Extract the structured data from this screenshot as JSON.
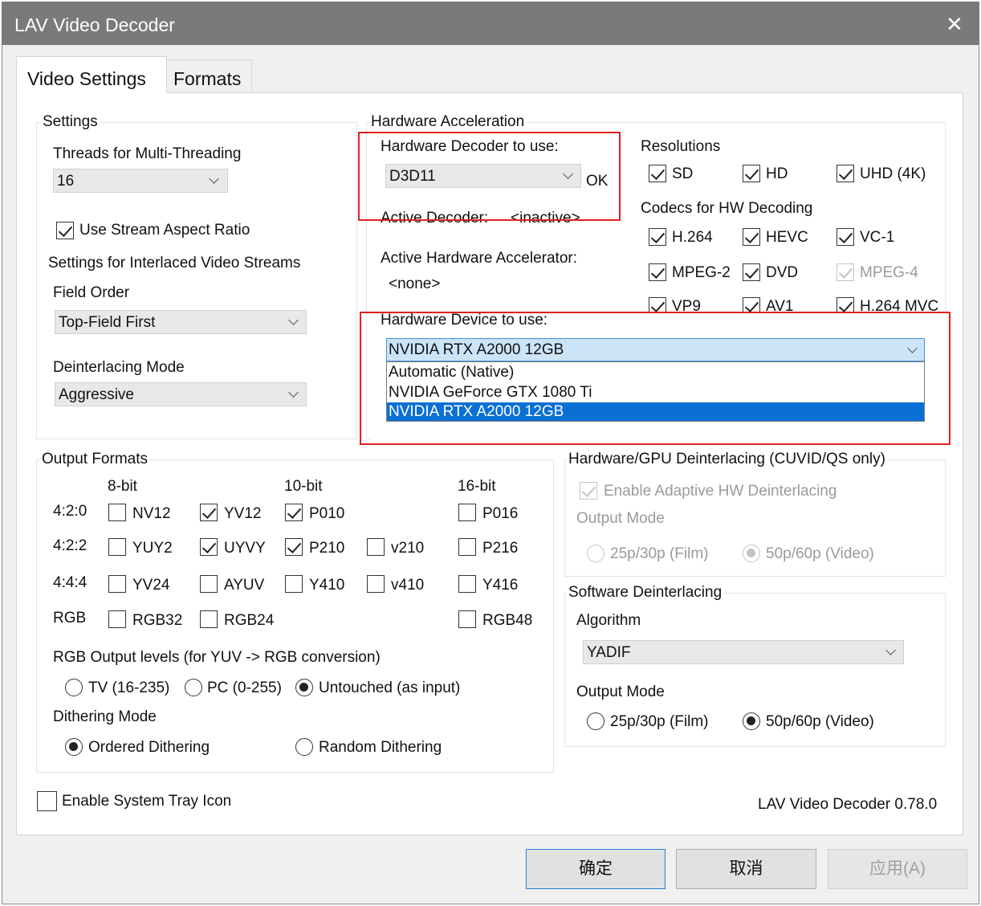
{
  "window": {
    "title": "LAV Video Decoder"
  },
  "tabs": [
    {
      "label": "Video Settings",
      "active": true
    },
    {
      "label": "Formats",
      "active": false
    }
  ],
  "settings": {
    "group_label": "Settings",
    "threads_label": "Threads for Multi-Threading",
    "threads_value": "16",
    "stream_aspect_label": "Use Stream Aspect Ratio",
    "interlaced_label": "Settings for Interlaced Video Streams",
    "field_order_label": "Field Order",
    "field_order_value": "Top-Field First",
    "deint_mode_label": "Deinterlacing Mode",
    "deint_mode_value": "Aggressive"
  },
  "hw_accel": {
    "group_label": "Hardware Acceleration",
    "decoder_label": "Hardware Decoder to use:",
    "decoder_value": "D3D11",
    "decoder_status": "OK",
    "active_decoder_label": "Active Decoder:",
    "active_decoder_value": "<inactive>",
    "active_accel_label": "Active Hardware Accelerator:",
    "active_accel_value": "<none>",
    "device_label": "Hardware Device to use:",
    "device_value": "NVIDIA RTX A2000 12GB",
    "device_options": [
      "Automatic (Native)",
      "NVIDIA GeForce GTX 1080 Ti",
      "NVIDIA RTX A2000 12GB"
    ]
  },
  "resolutions": {
    "label": "Resolutions",
    "items": [
      {
        "label": "SD",
        "checked": true
      },
      {
        "label": "HD",
        "checked": true
      },
      {
        "label": "UHD (4K)",
        "checked": true
      }
    ]
  },
  "codecs": {
    "label": "Codecs for HW Decoding",
    "items": [
      {
        "label": "H.264",
        "checked": true
      },
      {
        "label": "HEVC",
        "checked": true
      },
      {
        "label": "VC-1",
        "checked": true
      },
      {
        "label": "MPEG-2",
        "checked": true
      },
      {
        "label": "DVD",
        "checked": true
      },
      {
        "label": "MPEG-4",
        "checked": true,
        "disabled": true
      },
      {
        "label": "VP9",
        "checked": true
      },
      {
        "label": "AV1",
        "checked": true
      },
      {
        "label": "H.264 MVC",
        "checked": true
      }
    ]
  },
  "output_formats": {
    "group_label": "Output Formats",
    "col_8bit": "8-bit",
    "col_10bit": "10-bit",
    "col_16bit": "16-bit",
    "row_420": "4:2:0",
    "row_422": "4:2:2",
    "row_444": "4:4:4",
    "row_rgb": "RGB",
    "nv12": "NV12",
    "yv12": "YV12",
    "p010": "P010",
    "p016": "P016",
    "yuy2": "YUY2",
    "uyvy": "UYVY",
    "p210": "P210",
    "v210": "v210",
    "p216": "P216",
    "yv24": "YV24",
    "ayuv": "AYUV",
    "y410": "Y410",
    "v410": "v410",
    "y416": "Y416",
    "rgb32": "RGB32",
    "rgb24": "RGB24",
    "rgb48": "RGB48",
    "rgb_levels_label": "RGB Output levels (for YUV -> RGB conversion)",
    "tv_label": "TV (16-235)",
    "pc_label": "PC (0-255)",
    "untouched_label": "Untouched (as input)",
    "dithering_label": "Dithering Mode",
    "ordered_label": "Ordered Dithering",
    "random_label": "Random Dithering"
  },
  "hw_deint": {
    "group_label": "Hardware/GPU Deinterlacing (CUVID/QS only)",
    "adaptive_label": "Enable Adaptive HW Deinterlacing",
    "output_mode_label": "Output Mode",
    "film_label": "25p/30p (Film)",
    "video_label": "50p/60p (Video)"
  },
  "sw_deint": {
    "group_label": "Software Deinterlacing",
    "algorithm_label": "Algorithm",
    "algorithm_value": "YADIF",
    "output_mode_label": "Output Mode",
    "film_label": "25p/30p (Film)",
    "video_label": "50p/60p (Video)"
  },
  "footer": {
    "tray_label": "Enable System Tray Icon",
    "version": "LAV Video Decoder 0.78.0"
  },
  "buttons": {
    "ok": "确定",
    "cancel": "取消",
    "apply": "应用(A)"
  },
  "colors": {
    "titlebar": "#7a7a7a",
    "highlight": "#0a70d4",
    "annotation_box": "#e02020"
  }
}
